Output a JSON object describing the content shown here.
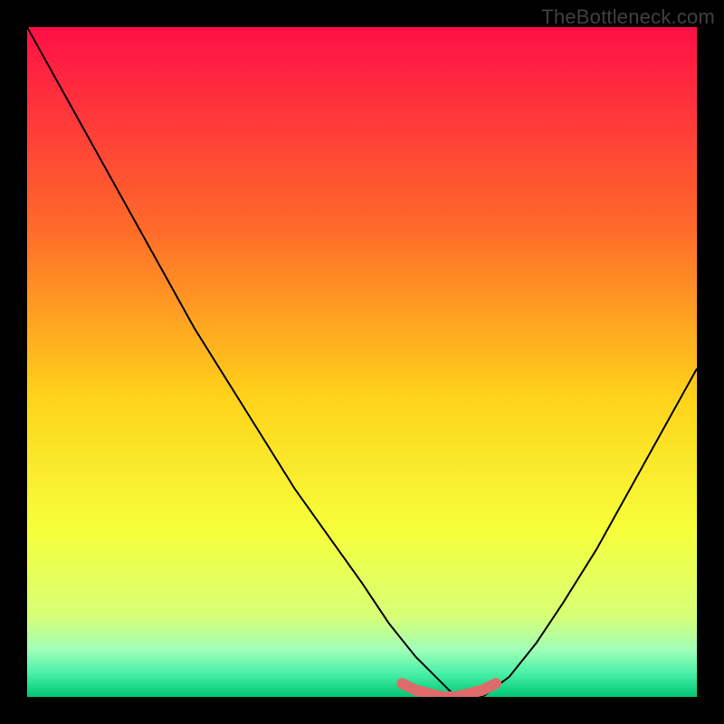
{
  "watermark": "TheBottleneck.com",
  "chart_data": {
    "type": "line",
    "title": "",
    "xlabel": "",
    "ylabel": "",
    "xlim": [
      0,
      100
    ],
    "ylim": [
      0,
      100
    ],
    "x": [
      0,
      5,
      10,
      15,
      20,
      25,
      30,
      35,
      40,
      45,
      50,
      54,
      58,
      62,
      64,
      68,
      72,
      76,
      80,
      85,
      90,
      95,
      100
    ],
    "values": [
      100,
      91,
      82,
      73,
      64,
      55,
      47,
      39,
      31,
      24,
      17,
      11,
      6,
      2,
      0,
      0,
      3,
      8,
      14,
      22,
      31,
      40,
      49
    ],
    "series": [
      {
        "name": "bottleneck-curve",
        "color": "#000000",
        "x": [
          0,
          5,
          10,
          15,
          20,
          25,
          30,
          35,
          40,
          45,
          50,
          54,
          58,
          62,
          64,
          68,
          72,
          76,
          80,
          85,
          90,
          95,
          100
        ],
        "y": [
          100,
          91,
          82,
          73,
          64,
          55,
          47,
          39,
          31,
          24,
          17,
          11,
          6,
          2,
          0,
          0,
          3,
          8,
          14,
          22,
          31,
          40,
          49
        ]
      },
      {
        "name": "optimal-band",
        "color": "#dd6b6b",
        "x": [
          56,
          58,
          60,
          62,
          64,
          66,
          68,
          70
        ],
        "y": [
          2,
          1,
          0.5,
          0,
          0,
          0.5,
          1,
          2
        ]
      }
    ],
    "gradient_stops": [
      {
        "offset": 0.0,
        "color": "#ff0f47"
      },
      {
        "offset": 0.3,
        "color": "#ff6a2a"
      },
      {
        "offset": 0.55,
        "color": "#ffd21a"
      },
      {
        "offset": 0.75,
        "color": "#f6ff3a"
      },
      {
        "offset": 0.88,
        "color": "#d7ff76"
      },
      {
        "offset": 0.93,
        "color": "#9fffb8"
      },
      {
        "offset": 0.965,
        "color": "#49f0a8"
      },
      {
        "offset": 1.0,
        "color": "#00c772"
      }
    ],
    "optimal_band_color": "#dd6b6b",
    "curve_color": "#000000",
    "background_outside": "#000000"
  }
}
